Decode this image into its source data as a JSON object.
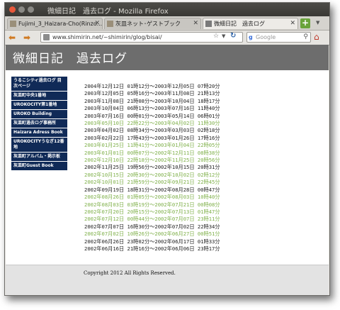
{
  "window": {
    "title": "微細日記　過去ログ - Mozilla Firefox"
  },
  "tabs": [
    {
      "label": "Fujimi_3_Haizara-Cho(Rinzo...",
      "active": false
    },
    {
      "label": "灰皿ネット･ゲストブック",
      "active": false
    },
    {
      "label": "微細日記　過去ログ",
      "active": true
    }
  ],
  "nav": {
    "url": "www.shimirin.net/~shimirin/glog/bisai/",
    "search_placeholder": "Google"
  },
  "page": {
    "title": "微細日記　過去ログ",
    "footer": "Copyright 2012 All Rights Reserved."
  },
  "menu": [
    "うるこシティ過去ログ 目次ページ",
    "灰皿町中央1番地",
    "UROKOCITY第1番地",
    "UROKO Building",
    "灰皿町過去ログ事務所",
    "Haizara Adress Book",
    "UROKOCITYうなぎ12番地",
    "灰皿町アルバム・掲示板",
    "灰皿町Guest Book"
  ],
  "log_entries": [
    {
      "text": "2004年12月12日 01時12分～2003年12月05日 07時20分",
      "alt": false
    },
    {
      "text": "2003年12月05日 05時16分～2003年11月08日 21時13分",
      "alt": false
    },
    {
      "text": "2003年11月08日 21時08分～2003年10月04日 18時17分",
      "alt": false
    },
    {
      "text": "2003年10月04日 06時13分～2003年07月16日 11時40分",
      "alt": false
    },
    {
      "text": "2003年07月16日 00時01分～2003年05月14日 06時01分",
      "alt": false
    },
    {
      "text": "2003年05月10日 22時22分～2003年04月02日 11時30分",
      "alt": true
    },
    {
      "text": "2003年04月02日 08時34分～2003年03月03日 02時18分",
      "alt": false
    },
    {
      "text": "2003年02月22日 17時43分～2003年01月26日 17時16分",
      "alt": false
    },
    {
      "text": "2003年01月25日 11時41分～2003年01月04日 22時05分",
      "alt": true
    },
    {
      "text": "2003年01月01日 00時07分～2002年12月11日 08時38分",
      "alt": true
    },
    {
      "text": "2002年12月10日 22時18分～2002年11月25日 20時56分",
      "alt": true
    },
    {
      "text": "2002年11月25日 19時56分～2002年10月15日 20時31分",
      "alt": false
    },
    {
      "text": "2002年10月15日 20時30分～2002年10月02日 02時12分",
      "alt": true
    },
    {
      "text": "2002年10月01日 21時59分～2002年09月21日 22時45分",
      "alt": true
    },
    {
      "text": "2002年09月19日 18時31分～2002年08月28日 00時47分",
      "alt": false
    },
    {
      "text": "2002年08月26日 01時05分～2002年08月03日 10時40分",
      "alt": true
    },
    {
      "text": "2002年08月03日 03時19分～2002年07月21日 00時08分",
      "alt": true
    },
    {
      "text": "2002年07月20日 20時15分～2002年07月13日 01時47分",
      "alt": true
    },
    {
      "text": "2002年07月12日 00時44分～2002年07月07日 23時11分",
      "alt": true
    },
    {
      "text": "2002年07月07日 16時30分～2002年07月02日 22時34分",
      "alt": false
    },
    {
      "text": "2002年07月02日 10時26分～2002年06月27日 00時51分",
      "alt": true
    },
    {
      "text": "2002年06月26日 23時02分～2002年06月17日 01時33分",
      "alt": false
    },
    {
      "text": "2002年06月16日 21時16分～2002年06月06日 23時17分",
      "alt": false
    }
  ],
  "colors": {
    "link_visited": "#7fb04a",
    "menu_bg": "#102a57",
    "header_bg": "#6d6d6d"
  },
  "icons": [
    "close-window-icon",
    "minimize-window-icon",
    "maximize-window-icon",
    "back-arrow-icon",
    "forward-arrow-icon",
    "bookmark-star-icon",
    "reload-icon",
    "search-icon",
    "home-icon"
  ]
}
